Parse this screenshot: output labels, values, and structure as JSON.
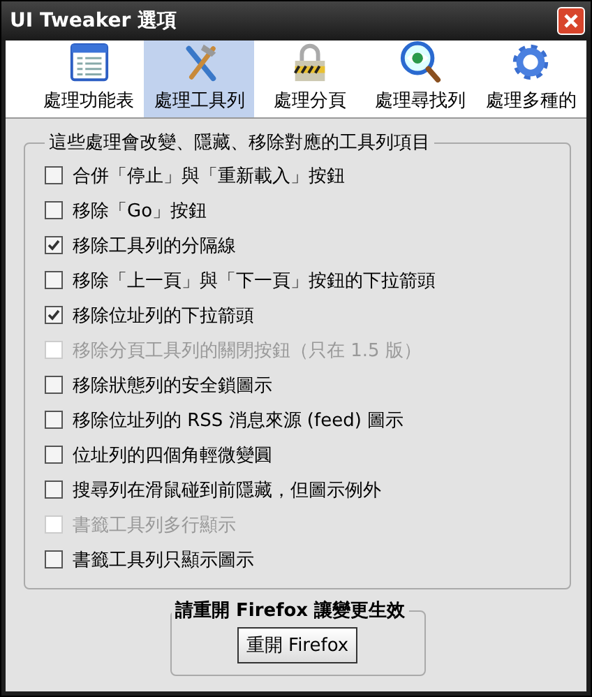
{
  "window": {
    "title": "UI Tweaker 選項"
  },
  "tabs": [
    {
      "label": "處理功能表",
      "selected": false
    },
    {
      "label": "處理工具列",
      "selected": true
    },
    {
      "label": "處理分頁",
      "selected": false
    },
    {
      "label": "處理尋找列",
      "selected": false
    },
    {
      "label": "處理多種的",
      "selected": false
    }
  ],
  "options_group": {
    "title": "這些處理會改變、隱藏、移除對應的工具列項目",
    "items": [
      {
        "label": "合併「停止」與「重新載入」按鈕",
        "checked": false,
        "disabled": false
      },
      {
        "label": "移除「Go」按鈕",
        "checked": false,
        "disabled": false
      },
      {
        "label": "移除工具列的分隔線",
        "checked": true,
        "disabled": false
      },
      {
        "label": "移除「上一頁」與「下一頁」按鈕的下拉箭頭",
        "checked": false,
        "disabled": false
      },
      {
        "label": "移除位址列的下拉箭頭",
        "checked": true,
        "disabled": false
      },
      {
        "label": "移除分頁工具列的關閉按鈕（只在 1.5 版）",
        "checked": false,
        "disabled": true
      },
      {
        "label": "移除狀態列的安全鎖圖示",
        "checked": false,
        "disabled": false
      },
      {
        "label": "移除位址列的 RSS 消息來源 (feed) 圖示",
        "checked": false,
        "disabled": false
      },
      {
        "label": "位址列的四個角輕微變圓",
        "checked": false,
        "disabled": false
      },
      {
        "label": "搜尋列在滑鼠碰到前隱藏，但圖示例外",
        "checked": false,
        "disabled": false
      },
      {
        "label": "書籤工具列多行顯示",
        "checked": false,
        "disabled": true
      },
      {
        "label": "書籤工具列只顯示圖示",
        "checked": false,
        "disabled": false
      }
    ]
  },
  "restart_group": {
    "title": "請重開 Firefox 讓變更生效",
    "button": "重開 Firefox"
  }
}
